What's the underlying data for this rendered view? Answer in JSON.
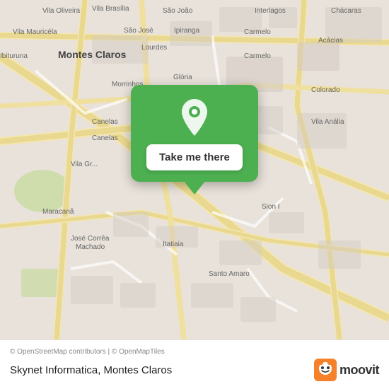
{
  "map": {
    "attribution": "© OpenStreetMap contributors | © OpenMapTiles",
    "popup": {
      "button_label": "Take me there"
    }
  },
  "bottom_bar": {
    "location_name": "Skynet Informatica, Montes Claros",
    "moovit_label": "moovit"
  },
  "colors": {
    "green": "#4caf50",
    "moovit_orange": "#f5812a"
  }
}
